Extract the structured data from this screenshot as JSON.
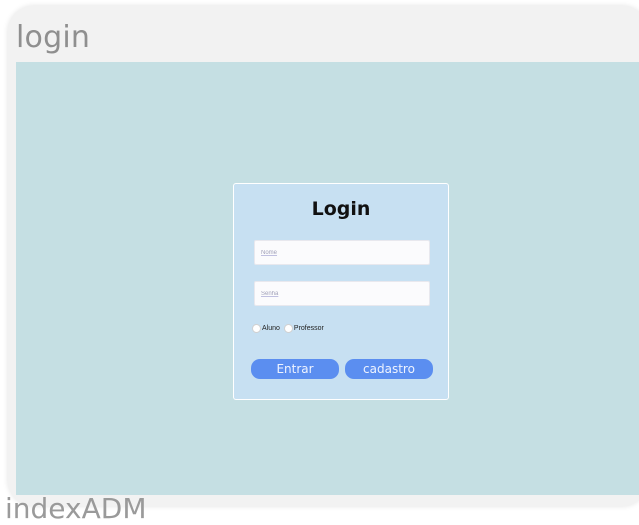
{
  "frame": {
    "title": "login"
  },
  "login_card": {
    "title": "Login",
    "nome_placeholder": "Nome",
    "senha_placeholder": "Senha",
    "radio_aluno_label": "Aluno",
    "radio_professor_label": "Professor",
    "entrar_label": "Entrar",
    "cadastro_label": "cadastro"
  },
  "next_frame": {
    "title": "indexADM"
  },
  "colors": {
    "viewport_bg": "#c5dfe3",
    "card_bg": "#c7e0f2",
    "button_bg": "#5b8ef0"
  }
}
